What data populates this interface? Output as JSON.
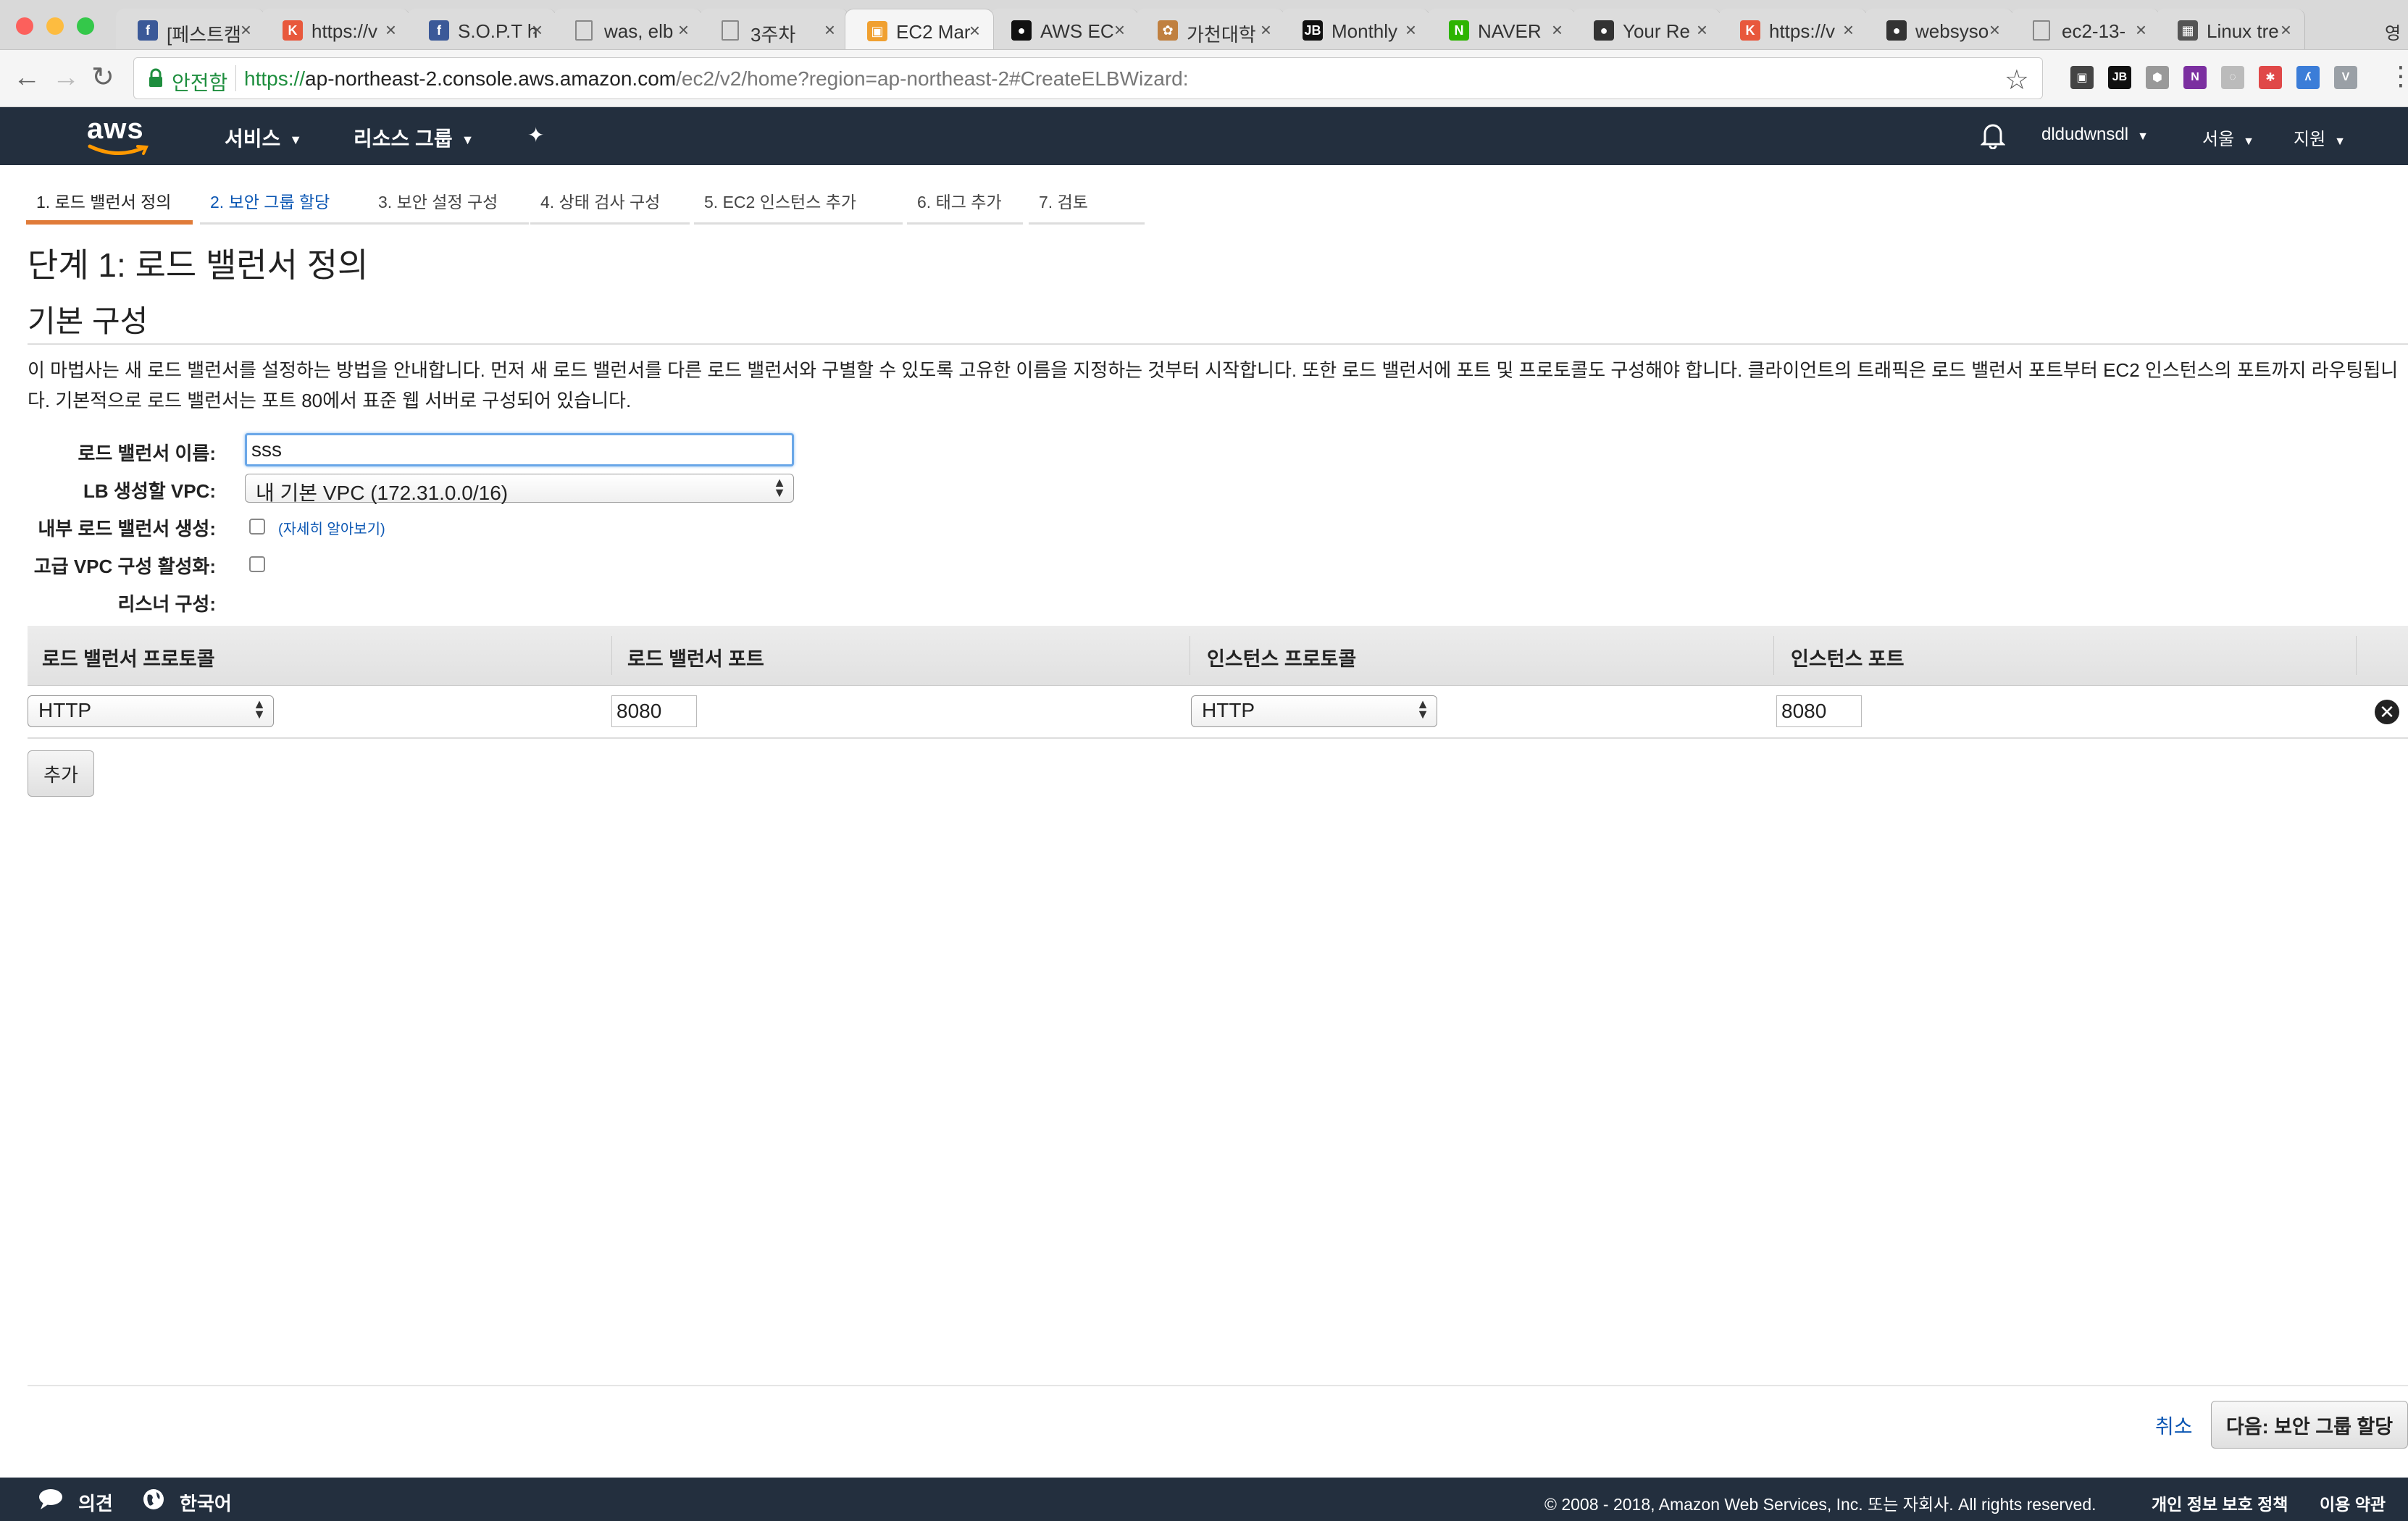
{
  "browser": {
    "tabs": [
      {
        "label": "[페스트캠",
        "favicon": "facebook",
        "color": "#3b5998"
      },
      {
        "label": "https://v",
        "favicon": "k-circle",
        "color": "#e8583c"
      },
      {
        "label": "S.O.P.T h",
        "favicon": "facebook",
        "color": "#3b5998"
      },
      {
        "label": "was, elb",
        "favicon": "document",
        "color": "#888888"
      },
      {
        "label": "3주차",
        "favicon": "document",
        "color": "#888888"
      },
      {
        "label": "EC2 Mar",
        "favicon": "aws-box",
        "color": "#f0a030"
      },
      {
        "label": "AWS EC",
        "favicon": "black-circle",
        "color": "#111111"
      },
      {
        "label": "가천대학",
        "favicon": "flower",
        "color": "#c08040"
      },
      {
        "label": "Monthly",
        "favicon": "jb",
        "color": "#111111"
      },
      {
        "label": "NAVER",
        "favicon": "naver-n",
        "color": "#2db400"
      },
      {
        "label": "Your Re",
        "favicon": "github",
        "color": "#333333"
      },
      {
        "label": "https://v",
        "favicon": "k-circle",
        "color": "#e8583c"
      },
      {
        "label": "websyso",
        "favicon": "github",
        "color": "#333333"
      },
      {
        "label": "ec2-13-",
        "favicon": "document",
        "color": "#888888"
      },
      {
        "label": "Linux tre",
        "favicon": "checker",
        "color": "#555555"
      }
    ],
    "active_tab_index": 5,
    "overflow_label": "영",
    "secure_label": "안전함",
    "url_scheme": "https://",
    "url_host": "ap-northeast-2.console.aws.amazon.com",
    "url_path": "/ec2/v2/home?region=ap-northeast-2#CreateELBWizard:",
    "extensions": [
      {
        "name": "puzzle-extension-icon",
        "color": "#444444",
        "glyph": "▣"
      },
      {
        "name": "jb-extension-icon",
        "color": "#111111",
        "glyph": "JB"
      },
      {
        "name": "cube-extension-icon",
        "color": "#999999",
        "glyph": "⬢"
      },
      {
        "name": "onenote-extension-icon",
        "color": "#7b2fa0",
        "glyph": "N"
      },
      {
        "name": "ghost-extension-icon",
        "color": "#bbbbbb",
        "glyph": "◌"
      },
      {
        "name": "asterisk-extension-icon",
        "color": "#e04848",
        "glyph": "✱"
      },
      {
        "name": "lambda-extension-icon",
        "color": "#3b7dd8",
        "glyph": "ʎ"
      },
      {
        "name": "vue-extension-icon",
        "color": "#9aa0a6",
        "glyph": "V"
      }
    ]
  },
  "aws_nav": {
    "logo_text": "aws",
    "services": "서비스",
    "resource_groups": "리소스 그룹",
    "user": "dldudwnsdl",
    "region": "서울",
    "support": "지원"
  },
  "wizard": {
    "steps": [
      "1. 로드 밸런서 정의",
      "2. 보안 그룹 할당",
      "3. 보안 설정 구성",
      "4. 상태 검사 구성",
      "5. EC2 인스턴스 추가",
      "6. 태그 추가",
      "7. 검토"
    ],
    "active_step": 0,
    "title": "단계 1: 로드 밸런서 정의",
    "section": "기본 구성",
    "description": "이 마법사는 새 로드 밸런서를 설정하는 방법을 안내합니다. 먼저 새 로드 밸런서를 다른 로드 밸런서와 구별할 수 있도록 고유한 이름을 지정하는 것부터 시작합니다. 또한 로드 밸런서에 포트 및 프로토콜도 구성해야 합니다. 클라이언트의 트래픽은 로드 밸런서 포트부터 EC2 인스턴스의 포트까지 라우팅됩니다. 기본적으로 로드 밸런서는 포트 80에서 표준 웹 서버로 구성되어 있습니다."
  },
  "form": {
    "lb_name_label": "로드 밸런서 이름:",
    "lb_name_value": "sss",
    "vpc_label": "LB 생성할 VPC:",
    "vpc_value": "내 기본 VPC (172.31.0.0/16)",
    "internal_label": "내부 로드 밸런서 생성:",
    "internal_checked": false,
    "learn_more": "(자세히 알아보기)",
    "advanced_vpc_label": "고급 VPC 구성 활성화:",
    "advanced_vpc_checked": false,
    "listener_label": "리스너 구성:"
  },
  "listeners": {
    "headers": [
      "로드 밸런서 프로토콜",
      "로드 밸런서 포트",
      "인스턴스 프로토콜",
      "인스턴스 포트"
    ],
    "rows": [
      {
        "lb_protocol": "HTTP",
        "lb_port": "8080",
        "instance_protocol": "HTTP",
        "instance_port": "8080"
      }
    ],
    "add_label": "추가"
  },
  "actions": {
    "cancel": "취소",
    "next": "다음: 보안 그룹 할당"
  },
  "footer": {
    "feedback": "의견",
    "language": "한국어",
    "copyright": "© 2008 - 2018, Amazon Web Services, Inc. 또는 자회사. All rights reserved.",
    "privacy": "개인 정보 보호 정책",
    "terms": "이용 약관"
  }
}
